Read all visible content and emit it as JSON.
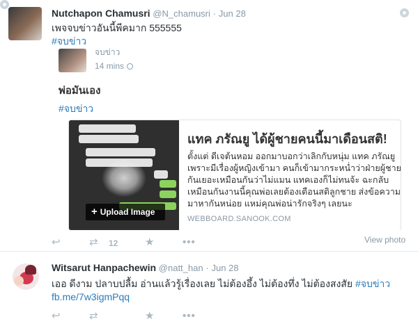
{
  "tweets": [
    {
      "name": "Nutchapon Chamusri",
      "handle": "@N_chamusri",
      "separator": "·",
      "date": "Jun 28",
      "text": "เพจจบข่าวอันนี้พีคมาก 555555",
      "hashtag": "#จบข่าว",
      "embedded": {
        "author": "จบข่าว",
        "time": "14 mins",
        "text": "พ่อมันเอง",
        "hashtag": "#จบข่าว",
        "card": {
          "upload_label": "Upload Image",
          "title": "แทค ภรัณยู ได้ผู้ชายคนนี้มาเดือนสติ!",
          "body_lines": [
            "ตั้งแต่ ดีเจต้นหอม ออกมาบอกว่าเลิกกับหนุ่ม แทค ภรัณยู",
            "เพราะมีเรื่องผู้หญิงเข้ามา คนก็เข้ามากระหน่ำว่าฝ่ายผู้ชาย",
            "กันเยอะเหมือนกันว่าไม่แมน แทคเองก็ไม่ทนจ้ะ ฉะกลับ",
            "เหมือนกันงานนี้คุณพ่อเลยต้องเตือนสติลูกชาย ส่งข้อความ",
            "มาหากันหน่อย แหม่คุณพ่อน่ารักจริงๆ เลยนะ"
          ],
          "domain": "WEBBOARD.SANOOK.COM"
        }
      },
      "view_photo": "View photo",
      "retweet_count": "12"
    },
    {
      "name": "Witsarut Hanpachewin",
      "handle": "@natt_han",
      "separator": "·",
      "date": "Jun 28",
      "text": "เออ ดีงาม ปลาบปลื้ม อ่านแล้วรู้เรื่องเลย ไม่ต้องอึ้ง ไม่ต้องทึ่ง ไม่ต้องสงสัย",
      "hashtag": "#จบข่าว",
      "link": "fb.me/7w3igmPqq"
    }
  ],
  "icons": {
    "reply": "reply-icon",
    "retweet": "retweet-icon",
    "favorite": "star-icon",
    "more": "more-icon",
    "gear": "gear-icon"
  },
  "colors": {
    "link": "#2b7bb9",
    "muted": "#8899a6",
    "action": "#aab8c2"
  }
}
